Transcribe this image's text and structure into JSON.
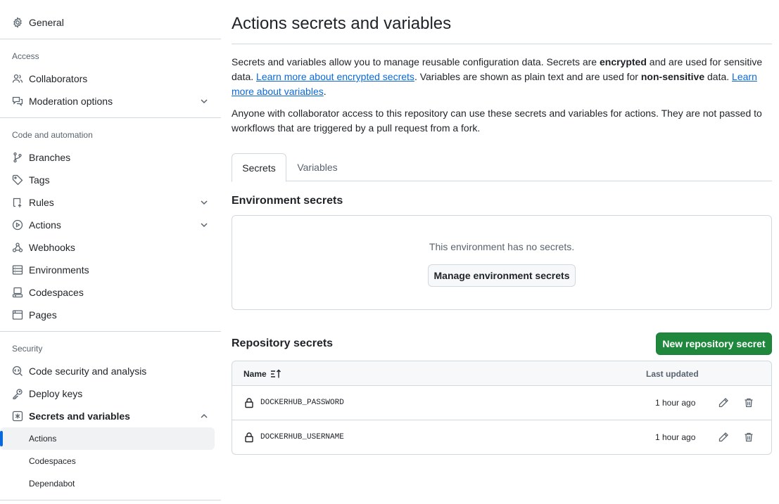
{
  "sidebar": {
    "general": "General",
    "sections": {
      "access": "Access",
      "code_automation": "Code and automation",
      "security": "Security"
    },
    "items": {
      "collaborators": "Collaborators",
      "moderation": "Moderation options",
      "branches": "Branches",
      "tags": "Tags",
      "rules": "Rules",
      "actions": "Actions",
      "webhooks": "Webhooks",
      "environments": "Environments",
      "codespaces": "Codespaces",
      "pages": "Pages",
      "code_security": "Code security and analysis",
      "deploy_keys": "Deploy keys",
      "secrets_variables": "Secrets and variables"
    },
    "sub_items": {
      "actions": "Actions",
      "codespaces": "Codespaces",
      "dependabot": "Dependabot"
    },
    "active_sub_item": "Actions"
  },
  "main": {
    "title": "Actions secrets and variables",
    "intro": {
      "p1_part1": "Secrets and variables allow you to manage reusable configuration data. Secrets are ",
      "p1_bold1": "encrypted",
      "p1_part2": " and are used for sensitive data. ",
      "p1_link1": "Learn more about encrypted secrets",
      "p1_part3": ". Variables are shown as plain text and are used for ",
      "p1_bold2": "non-sensitive",
      "p1_part4": " data. ",
      "p1_link2": "Learn more about variables",
      "p1_part5": ".",
      "p2": "Anyone with collaborator access to this repository can use these secrets and variables for actions. They are not passed to workflows that are triggered by a pull request from a fork."
    },
    "tabs": [
      "Secrets",
      "Variables"
    ],
    "selected_tab": "Secrets",
    "environment_secrets": {
      "heading": "Environment secrets",
      "empty_text": "This environment has no secrets.",
      "manage_button": "Manage environment secrets"
    },
    "repository_secrets": {
      "heading": "Repository secrets",
      "new_button": "New repository secret",
      "columns": {
        "name": "Name",
        "last_updated": "Last updated"
      },
      "rows": [
        {
          "name": "DOCKERHUB_PASSWORD",
          "updated": "1 hour ago"
        },
        {
          "name": "DOCKERHUB_USERNAME",
          "updated": "1 hour ago"
        }
      ]
    }
  },
  "colors": {
    "primary_button": "#1f883d",
    "link": "#0969da",
    "active_indicator": "#0969da"
  }
}
